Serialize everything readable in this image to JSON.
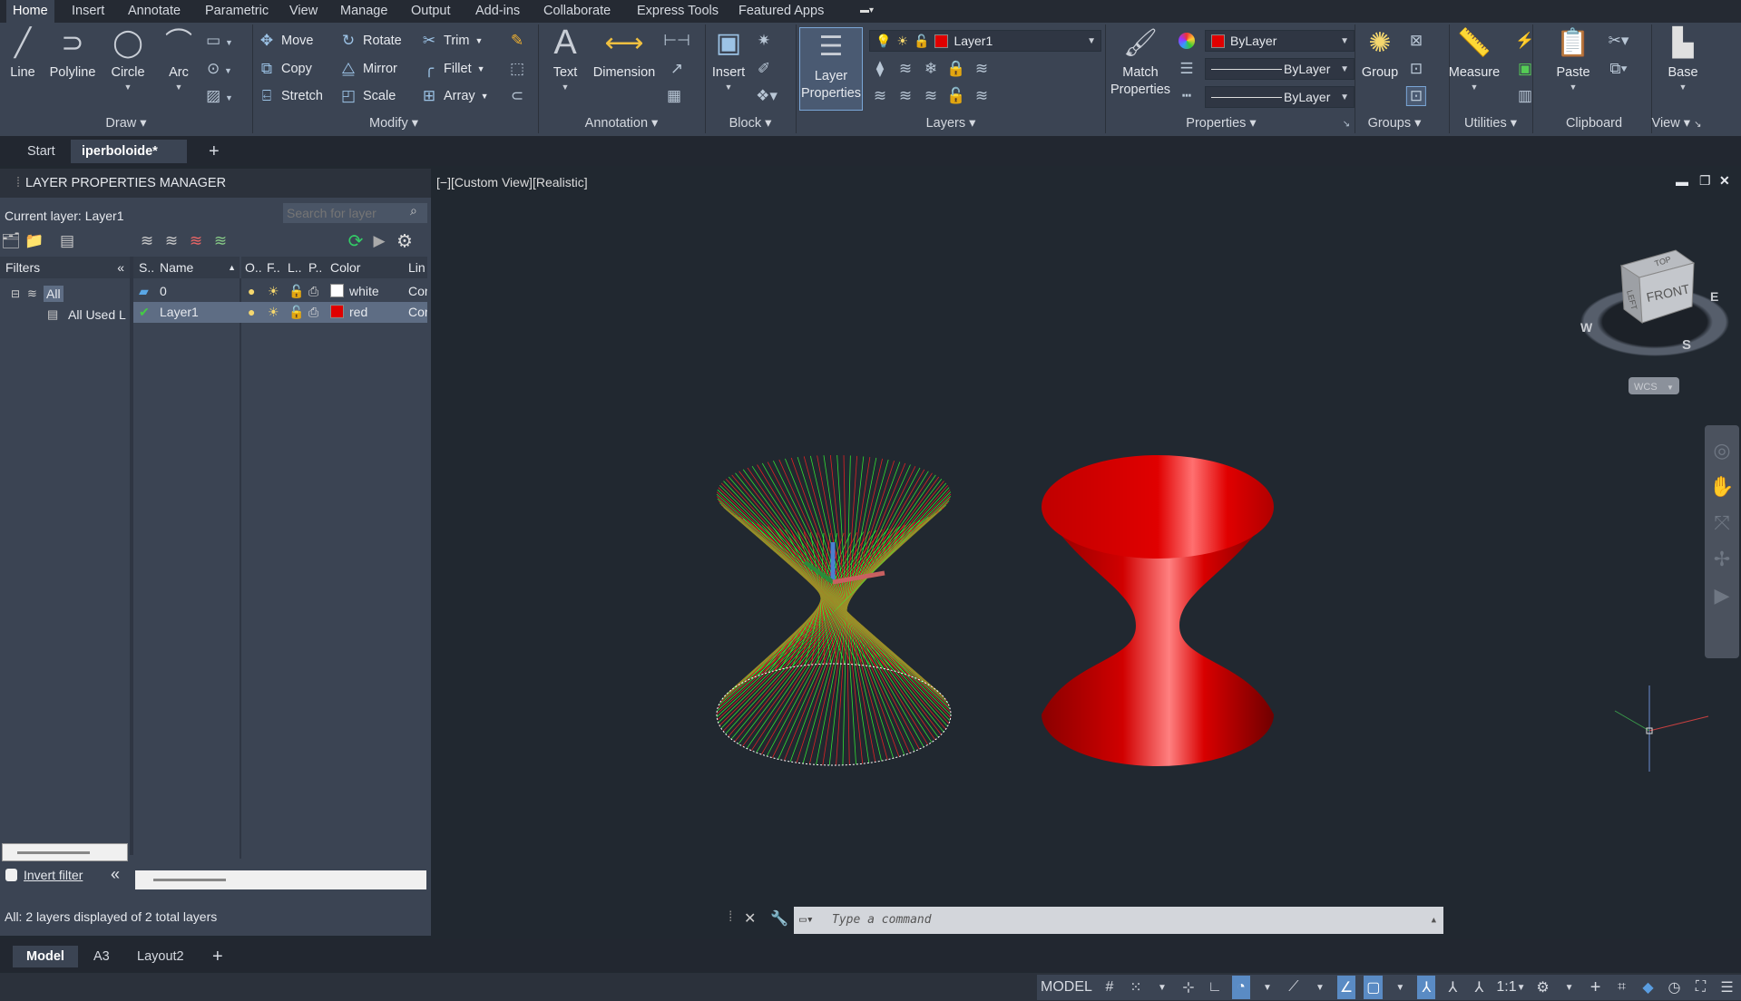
{
  "menu_tabs": [
    "Home",
    "Insert",
    "Annotate",
    "Parametric",
    "View",
    "Manage",
    "Output",
    "Add-ins",
    "Collaborate",
    "Express Tools",
    "Featured Apps"
  ],
  "ribbon": {
    "draw": {
      "label": "Draw",
      "line": "Line",
      "polyline": "Polyline",
      "circle": "Circle",
      "arc": "Arc"
    },
    "modify": {
      "label": "Modify",
      "move": "Move",
      "copy": "Copy",
      "stretch": "Stretch",
      "rotate": "Rotate",
      "mirror": "Mirror",
      "scale": "Scale",
      "trim": "Trim",
      "fillet": "Fillet",
      "array": "Array"
    },
    "annotation": {
      "label": "Annotation",
      "text": "Text",
      "dimension": "Dimension"
    },
    "block": {
      "label": "Block",
      "insert": "Insert"
    },
    "layers": {
      "label": "Layers",
      "layer_properties_1": "Layer",
      "layer_properties_2": "Properties",
      "current": "Layer1",
      "current_color": "#e00000"
    },
    "properties": {
      "label": "Properties",
      "match_1": "Match",
      "match_2": "Properties",
      "color": "ByLayer",
      "linetype": "ByLayer",
      "lineweight": "ByLayer"
    },
    "groups": {
      "label": "Groups",
      "group": "Group"
    },
    "utilities": {
      "label": "Utilities",
      "measure": "Measure"
    },
    "clipboard": {
      "label": "Clipboard",
      "paste": "Paste"
    },
    "view": {
      "label": "View",
      "base": "Base"
    }
  },
  "doc_tabs": {
    "start": "Start",
    "active": "iperboloide*"
  },
  "layer_panel": {
    "title": "LAYER PROPERTIES MANAGER",
    "current_layer": "Current layer: Layer1",
    "search_placeholder": "Search for layer",
    "filters_label": "Filters",
    "tree": [
      "All",
      "All Used L"
    ],
    "columns": {
      "status": "S..",
      "name": "Name",
      "on": "O..",
      "freeze": "F..",
      "lock": "L..",
      "plot": "P..",
      "color": "Color",
      "linetype": "Lin"
    },
    "layers": [
      {
        "name": "0",
        "color_name": "white",
        "color": "#ffffff",
        "linetype": "Cor",
        "current": false
      },
      {
        "name": "Layer1",
        "color_name": "red",
        "color": "#e00000",
        "linetype": "Cor",
        "current": true
      }
    ],
    "invert_filter": "Invert filter",
    "invert_checked": false,
    "status": "All: 2 layers displayed of 2 total layers"
  },
  "viewport": {
    "label": "[−][Custom View][Realistic]",
    "viewcube": {
      "top": "TOP",
      "left": "LEFT",
      "front": "FRONT",
      "west": "W",
      "east": "E",
      "south": "S",
      "wcs": "WCS"
    }
  },
  "command": {
    "placeholder": "Type a command"
  },
  "layout_tabs": [
    "Model",
    "A3",
    "Layout2"
  ],
  "status_bar": {
    "model": "MODEL",
    "scale": "1:1"
  },
  "colors": {
    "accent": "#5a8bc4",
    "solid": "#d40000",
    "wire_green": "#33ff33",
    "wire_red": "#ff2020"
  }
}
